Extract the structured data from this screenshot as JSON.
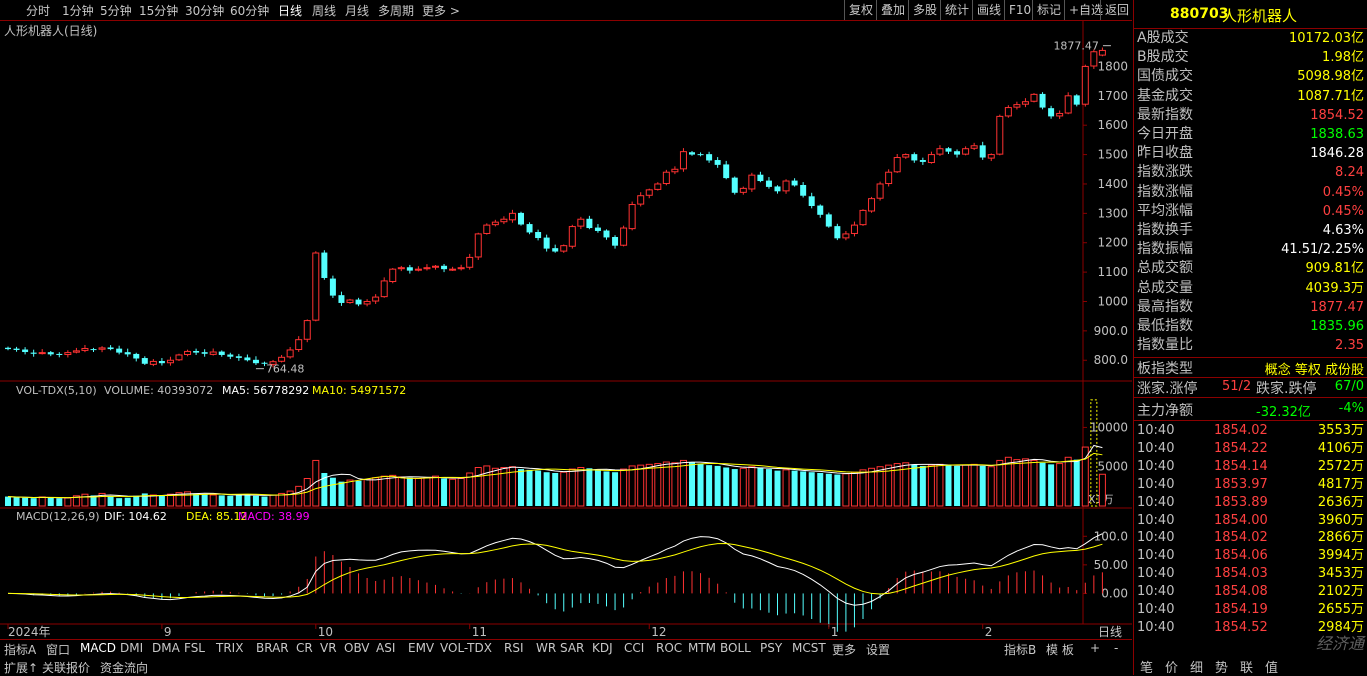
{
  "toolbar": {
    "periods": [
      "分时",
      "1分钟",
      "5分钟",
      "15分钟",
      "30分钟",
      "60分钟",
      "日线",
      "周线",
      "月线",
      "多周期",
      "更多 >"
    ],
    "selected": "日线",
    "right": [
      "复权",
      "叠加",
      "多股",
      "统计",
      "画线",
      "F10",
      "标记",
      "+自选",
      "返回"
    ]
  },
  "main_title": "人形机器人(日线)",
  "vol_header": {
    "name": "VOL-TDX(5,10)",
    "volume": "VOLUME: 40393072",
    "ma5": "MA5: 56778292",
    "ma10": "MA10: 54971572"
  },
  "macd_header": {
    "name": "MACD(12,26,9)",
    "dif": "DIF: 104.62",
    "dea": "DEA: 85.12",
    "macd": "MACD: 38.99"
  },
  "vol_unit": "X1万",
  "colors": {
    "up": "#ff3232",
    "down": "#54ffff",
    "ma5": "#ffffff",
    "ma10": "#ffff00",
    "macd_label": "#ff00ff",
    "frame": "#8b0000"
  },
  "chart_data": [
    {
      "type": "candlestick",
      "title": "人形机器人(日线)",
      "ylim": [
        760,
        1890
      ],
      "yticks": [
        "800.0",
        "900.0",
        "1000",
        "1100",
        "1200",
        "1300",
        "1400",
        "1500",
        "1600",
        "1700",
        "1800"
      ],
      "ytick_values": [
        800,
        900,
        1000,
        1100,
        1200,
        1300,
        1400,
        1500,
        1600,
        1700,
        1800
      ],
      "xticks": [
        {
          "label": "2024年",
          "i": 0
        },
        {
          "label": "9",
          "i": 18
        },
        {
          "label": "10",
          "i": 36
        },
        {
          "label": "11",
          "i": 54
        },
        {
          "label": "12",
          "i": 75
        },
        {
          "label": "1",
          "i": 96
        },
        {
          "label": "2",
          "i": 114
        }
      ],
      "annotations": [
        {
          "text": "1877.47",
          "i": 129,
          "value": 1877.47
        },
        {
          "text": "764.48",
          "i": 29,
          "value": 764.48
        }
      ],
      "closes": [
        838,
        835,
        828,
        822,
        826,
        820,
        818,
        826,
        832,
        840,
        836,
        842,
        838,
        826,
        820,
        806,
        788,
        796,
        790,
        800,
        818,
        830,
        826,
        822,
        828,
        818,
        812,
        808,
        800,
        790,
        788,
        795,
        810,
        835,
        870,
        935,
        1165,
        1080,
        1020,
        995,
        1005,
        990,
        1000,
        1015,
        1070,
        1110,
        1115,
        1105,
        1110,
        1115,
        1120,
        1110,
        1110,
        1115,
        1150,
        1230,
        1260,
        1270,
        1280,
        1300,
        1262,
        1235,
        1216,
        1180,
        1170,
        1190,
        1255,
        1280,
        1250,
        1240,
        1218,
        1190,
        1250,
        1330,
        1360,
        1380,
        1400,
        1440,
        1450,
        1510,
        1500,
        1500,
        1480,
        1465,
        1420,
        1370,
        1385,
        1430,
        1410,
        1390,
        1375,
        1410,
        1395,
        1360,
        1325,
        1295,
        1255,
        1215,
        1230,
        1260,
        1310,
        1350,
        1400,
        1440,
        1490,
        1500,
        1480,
        1475,
        1500,
        1520,
        1510,
        1500,
        1520,
        1530,
        1490,
        1500,
        1630,
        1660,
        1670,
        1680,
        1705,
        1660,
        1630,
        1640,
        1700,
        1670,
        1800,
        1850,
        1854.52
      ],
      "volumes": [
        1200,
        1100,
        1050,
        1000,
        1150,
        1080,
        980,
        1020,
        1300,
        1500,
        1350,
        1600,
        1250,
        1000,
        1050,
        1300,
        1600,
        1400,
        1300,
        1500,
        1700,
        1800,
        1600,
        1500,
        1400,
        1350,
        1300,
        1450,
        1500,
        1300,
        1200,
        1400,
        1600,
        1900,
        2500,
        3500,
        5800,
        4200,
        3600,
        3100,
        3300,
        3200,
        3400,
        3600,
        3800,
        3900,
        3700,
        3600,
        3500,
        3600,
        3800,
        3500,
        3400,
        3500,
        4200,
        4900,
        5100,
        4800,
        4900,
        5000,
        4700,
        4600,
        4500,
        4300,
        4200,
        4300,
        4700,
        4900,
        4800,
        4600,
        4400,
        4300,
        4700,
        5100,
        5200,
        5300,
        5400,
        5600,
        5500,
        5800,
        5600,
        5400,
        5200,
        5100,
        4900,
        4700,
        4800,
        5000,
        4900,
        4700,
        4500,
        4600,
        4500,
        4400,
        4300,
        4200,
        4100,
        4000,
        4100,
        4300,
        4600,
        4800,
        5000,
        5200,
        5400,
        5500,
        5300,
        5100,
        5200,
        5300,
        5200,
        5100,
        5200,
        5300,
        5100,
        5000,
        5800,
        6200,
        5900,
        6000,
        5800,
        5500,
        5300,
        5400,
        6200,
        5900,
        7500,
        13500,
        4039
      ]
    },
    {
      "type": "bar",
      "title": "VOL-TDX(5,10)",
      "ylim": [
        0,
        14000
      ],
      "yticks": [
        "5000",
        "10000"
      ],
      "ytick_values": [
        5000,
        10000
      ]
    },
    {
      "type": "line",
      "title": "MACD(12,26,9)",
      "ylim": [
        -50,
        125
      ],
      "yticks": [
        "0.00",
        "50.00",
        "100.0"
      ],
      "ytick_values": [
        0,
        50,
        100
      ],
      "series": [
        {
          "name": "DIF",
          "final": 104.62
        },
        {
          "name": "DEA",
          "final": 85.12
        },
        {
          "name": "MACD",
          "final": 38.99
        }
      ]
    }
  ],
  "side": {
    "code": "880703",
    "name": "人形机器人",
    "stats": [
      {
        "k": "A股成交",
        "v": "10172.03亿",
        "c": "#ffff00"
      },
      {
        "k": "B股成交",
        "v": "1.98亿",
        "c": "#ffff00"
      },
      {
        "k": "国债成交",
        "v": "5098.98亿",
        "c": "#ffff00"
      },
      {
        "k": "基金成交",
        "v": "1087.71亿",
        "c": "#ffff00"
      },
      {
        "k": "最新指数",
        "v": "1854.52",
        "c": "#ff4040"
      },
      {
        "k": "今日开盘",
        "v": "1838.63",
        "c": "#00ff00"
      },
      {
        "k": "昨日收盘",
        "v": "1846.28",
        "c": "#ffffff"
      },
      {
        "k": "指数涨跌",
        "v": "8.24",
        "c": "#ff4040"
      },
      {
        "k": "指数涨幅",
        "v": "0.45%",
        "c": "#ff4040"
      },
      {
        "k": "平均涨幅",
        "v": "0.45%",
        "c": "#ff4040"
      },
      {
        "k": "指数换手",
        "v": "4.63%",
        "c": "#ffffff"
      },
      {
        "k": "指数振幅",
        "v": "41.51/2.25%",
        "c": "#ffffff"
      },
      {
        "k": "总成交额",
        "v": "909.81亿",
        "c": "#ffff00"
      },
      {
        "k": "总成交量",
        "v": "4039.3万",
        "c": "#ffff00"
      },
      {
        "k": "最高指数",
        "v": "1877.47",
        "c": "#ff4040"
      },
      {
        "k": "最低指数",
        "v": "1835.96",
        "c": "#00ff00"
      },
      {
        "k": "指数量比",
        "v": "2.35",
        "c": "#ff4040"
      }
    ],
    "type_label": "板指类型",
    "type_value": "概念 等权 成份股",
    "rise_label": "涨家.涨停",
    "rise_value": "51/2",
    "fall_label": "跌家.跌停",
    "fall_value": "67/0",
    "main_label": "主力净额",
    "main_value": "-32.32亿",
    "main_pct": "-4%",
    "ticks": [
      {
        "t": "10:40",
        "p": "1854.02",
        "q": "3553万"
      },
      {
        "t": "10:40",
        "p": "1854.22",
        "q": "4106万"
      },
      {
        "t": "10:40",
        "p": "1854.14",
        "q": "2572万"
      },
      {
        "t": "10:40",
        "p": "1853.97",
        "q": "4817万"
      },
      {
        "t": "10:40",
        "p": "1853.89",
        "q": "2636万"
      },
      {
        "t": "10:40",
        "p": "1854.00",
        "q": "3960万"
      },
      {
        "t": "10:40",
        "p": "1854.02",
        "q": "2866万"
      },
      {
        "t": "10:40",
        "p": "1854.06",
        "q": "3994万"
      },
      {
        "t": "10:40",
        "p": "1854.03",
        "q": "3453万"
      },
      {
        "t": "10:40",
        "p": "1854.08",
        "q": "2102万"
      },
      {
        "t": "10:40",
        "p": "1854.19",
        "q": "2655万"
      },
      {
        "t": "10:40",
        "p": "1854.52",
        "q": "2984万"
      }
    ],
    "tabs": [
      "笔",
      "价",
      "细",
      "势",
      "联",
      "值"
    ]
  },
  "bottom": {
    "tab_a": "指标A",
    "indicators": [
      "窗口",
      "MACD",
      "DMI",
      "DMA",
      "FSL",
      "TRIX",
      "BRAR",
      "CR",
      "VR",
      "OBV",
      "ASI",
      "EMV",
      "VOL-TDX",
      "RSI",
      "WR",
      "SAR",
      "KDJ",
      "CCI",
      "ROC",
      "MTM",
      "BOLL",
      "PSY",
      "MCST",
      "更多",
      "设置"
    ],
    "selected": "MACD",
    "tab_b": "指标B",
    "model": "模 板",
    "plus": "+",
    "minus": "-",
    "row2": [
      "扩展↑",
      "关联报价",
      "资金流向"
    ],
    "period_right": "日线",
    "watermark": "经济通"
  }
}
